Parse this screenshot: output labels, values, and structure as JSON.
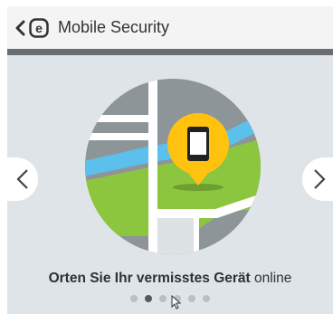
{
  "header": {
    "title": "Mobile Security",
    "logo_letter": "e"
  },
  "slide": {
    "caption_bold": "Orten Sie Ihr vermisstes Gerät",
    "caption_rest": " online",
    "page_count": 6,
    "active_page": 1
  },
  "colors": {
    "header_bg": "#f4f4f4",
    "divider": "#6b6e70",
    "hero_bg": "#dfe4e8",
    "map_gray": "#8e9599",
    "water": "#5bc0eb",
    "grass": "#8cc63f",
    "pin": "#ffc20e"
  },
  "icons": {
    "back": "chevron-left-icon",
    "logo": "eset-logo",
    "prev": "chevron-left-icon",
    "next": "chevron-right-icon",
    "pin": "location-pin-icon",
    "phone": "smartphone-icon"
  }
}
